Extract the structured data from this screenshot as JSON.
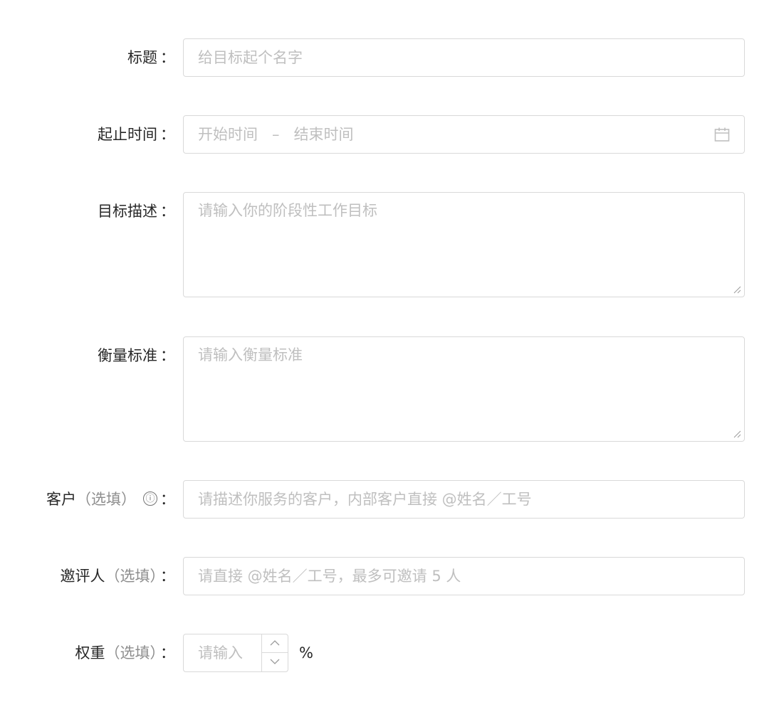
{
  "form": {
    "colon": "：",
    "title": {
      "label": "标题",
      "placeholder": "给目标起个名字"
    },
    "date_range": {
      "label": "起止时间",
      "start_placeholder": "开始时间",
      "separator": "–",
      "end_placeholder": "结束时间",
      "icon": "calendar-icon"
    },
    "goal": {
      "label": "目标描述",
      "placeholder": "请输入你的阶段性工作目标"
    },
    "standard": {
      "label": "衡量标准",
      "placeholder": "请输入衡量标准"
    },
    "client": {
      "label": "客户",
      "optional": "（选填）",
      "info_icon": "ⓘ",
      "placeholder": "请描述你服务的客户，内部客户直接 @姓名／工号"
    },
    "reviewer": {
      "label": "邀评人",
      "optional": "（选填）",
      "placeholder": "请直接 @姓名／工号，最多可邀请 5 人"
    },
    "weight": {
      "label": "权重",
      "optional": "（选填）",
      "placeholder": "请输入",
      "unit": "%"
    }
  }
}
